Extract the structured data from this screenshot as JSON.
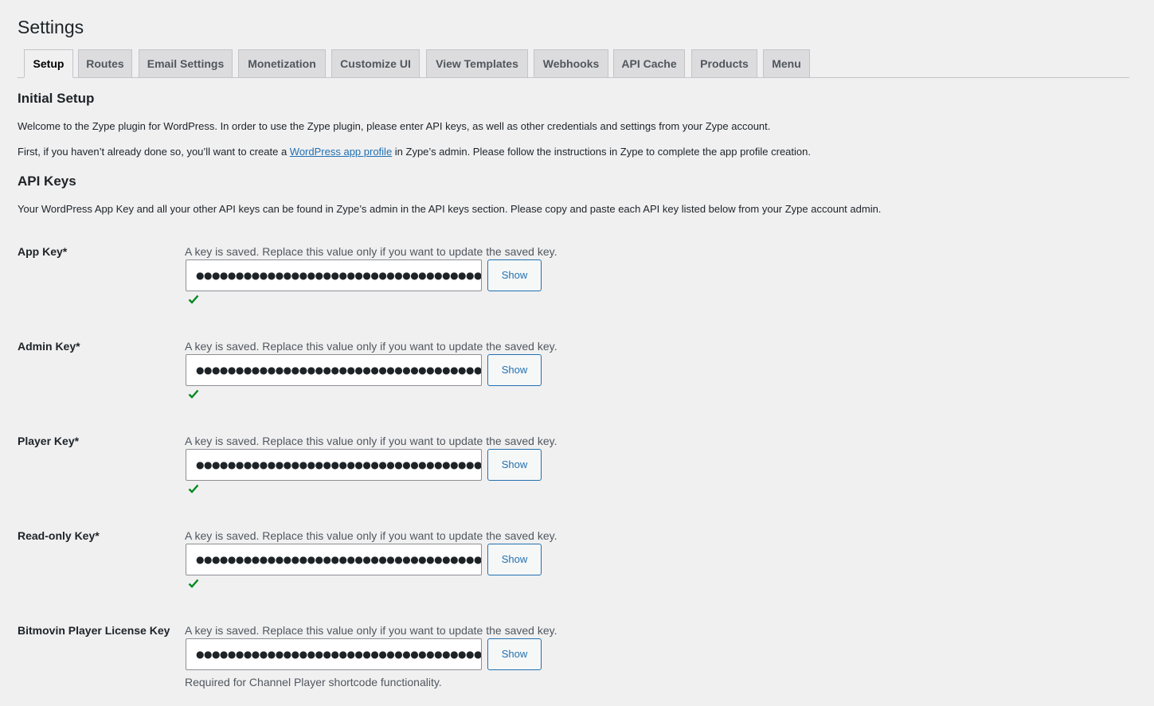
{
  "page": {
    "title": "Settings"
  },
  "tabs": [
    {
      "label": "Setup",
      "active": true
    },
    {
      "label": "Routes"
    },
    {
      "label": "Email Settings"
    },
    {
      "label": "Monetization"
    },
    {
      "label": "Customize UI"
    },
    {
      "label": "View Templates"
    },
    {
      "label": "Webhooks"
    },
    {
      "label": "API Cache"
    },
    {
      "label": "Products"
    },
    {
      "label": "Menu"
    }
  ],
  "initial_setup": {
    "heading": "Initial Setup",
    "paragraph1": "Welcome to the Zype plugin for WordPress. In order to use the Zype plugin, please enter API keys, as well as other credentials and settings from your Zype account.",
    "paragraph2_before": "First, if you haven’t already done so, you’ll want to create a ",
    "paragraph2_link": "WordPress app profile",
    "paragraph2_after": " in Zype’s admin. Please follow the instructions in Zype to complete the app profile creation."
  },
  "api_keys": {
    "heading": "API Keys",
    "intro": "Your WordPress App Key and all your other API keys can be found in Zype’s admin in the API keys section. Please copy and paste each API key listed below from your Zype account admin.",
    "saved_hint": "A key is saved. Replace this value only if you want to update the saved key.",
    "show_label": "Show",
    "fields": [
      {
        "label": "App Key*",
        "masked": "●●●●●●●●●●●●●●●●●●●●●●●●●●●●●●●●●●●●●●●●●●●●●●●●",
        "valid": true
      },
      {
        "label": "Admin Key*",
        "masked": "●●●●●●●●●●●●●●●●●●●●●●●●●●●●●●●●●●●●●●●●●●●●●●●●",
        "valid": true
      },
      {
        "label": "Player Key*",
        "masked": "●●●●●●●●●●●●●●●●●●●●●●●●●●●●●●●●●●●●●●●●●●●●●●●●",
        "valid": true
      },
      {
        "label": "Read-only Key*",
        "masked": "●●●●●●●●●●●●●●●●●●●●●●●●●●●●●●●●●●●●●●●●●●●●●●●●",
        "valid": true
      },
      {
        "label": "Bitmovin Player License Key",
        "masked": "●●●●●●●●●●●●●●●●●●●●●●●●●●●●●●●●●●●●",
        "valid": false,
        "description": "Required for Channel Player shortcode functionality."
      }
    ]
  },
  "colors": {
    "accent": "#2271b1",
    "success": "#008a20",
    "background": "#f0f0f1"
  }
}
